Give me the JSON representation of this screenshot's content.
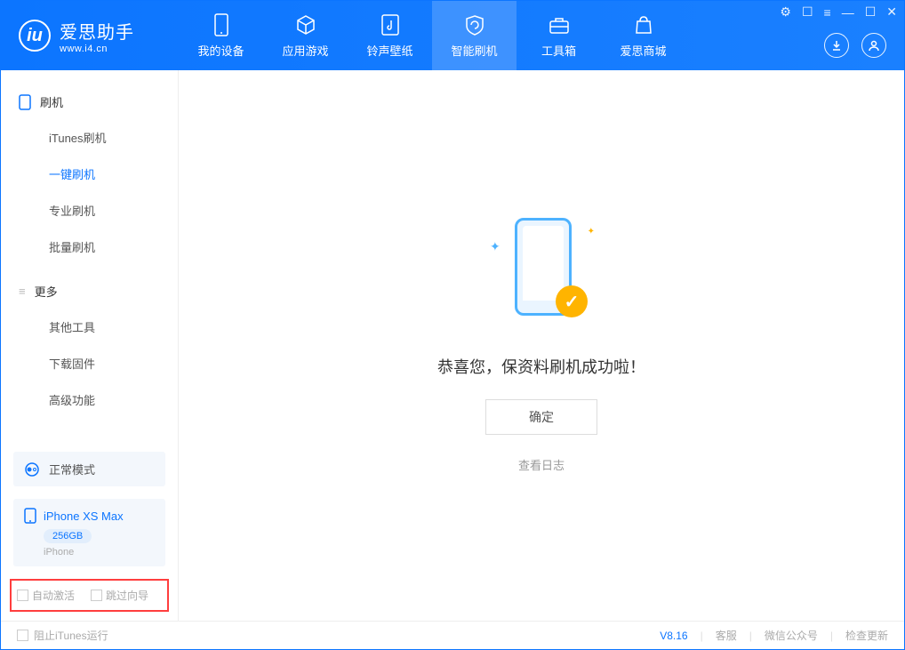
{
  "app": {
    "name_cn": "爱思助手",
    "name_en": "www.i4.cn"
  },
  "tabs": {
    "my_device": "我的设备",
    "apps_games": "应用游戏",
    "ringtones_wallpapers": "铃声壁纸",
    "smart_flash": "智能刷机",
    "toolbox": "工具箱",
    "store": "爱思商城"
  },
  "sidebar": {
    "section_flash": "刷机",
    "items_flash": {
      "itunes": "iTunes刷机",
      "one_click": "一键刷机",
      "professional": "专业刷机",
      "batch": "批量刷机"
    },
    "section_more": "更多",
    "items_more": {
      "other_tools": "其他工具",
      "download_firmware": "下载固件",
      "advanced": "高级功能"
    }
  },
  "mode": {
    "label": "正常模式"
  },
  "device": {
    "name": "iPhone XS Max",
    "capacity": "256GB",
    "type": "iPhone"
  },
  "checkboxes": {
    "auto_activate": "自动激活",
    "skip_wizard": "跳过向导"
  },
  "main": {
    "success_text": "恭喜您，保资料刷机成功啦！",
    "ok_label": "确定",
    "view_log": "查看日志"
  },
  "footer": {
    "block_itunes": "阻止iTunes运行",
    "version": "V8.16",
    "customer_service": "客服",
    "wechat": "微信公众号",
    "check_update": "检查更新"
  }
}
